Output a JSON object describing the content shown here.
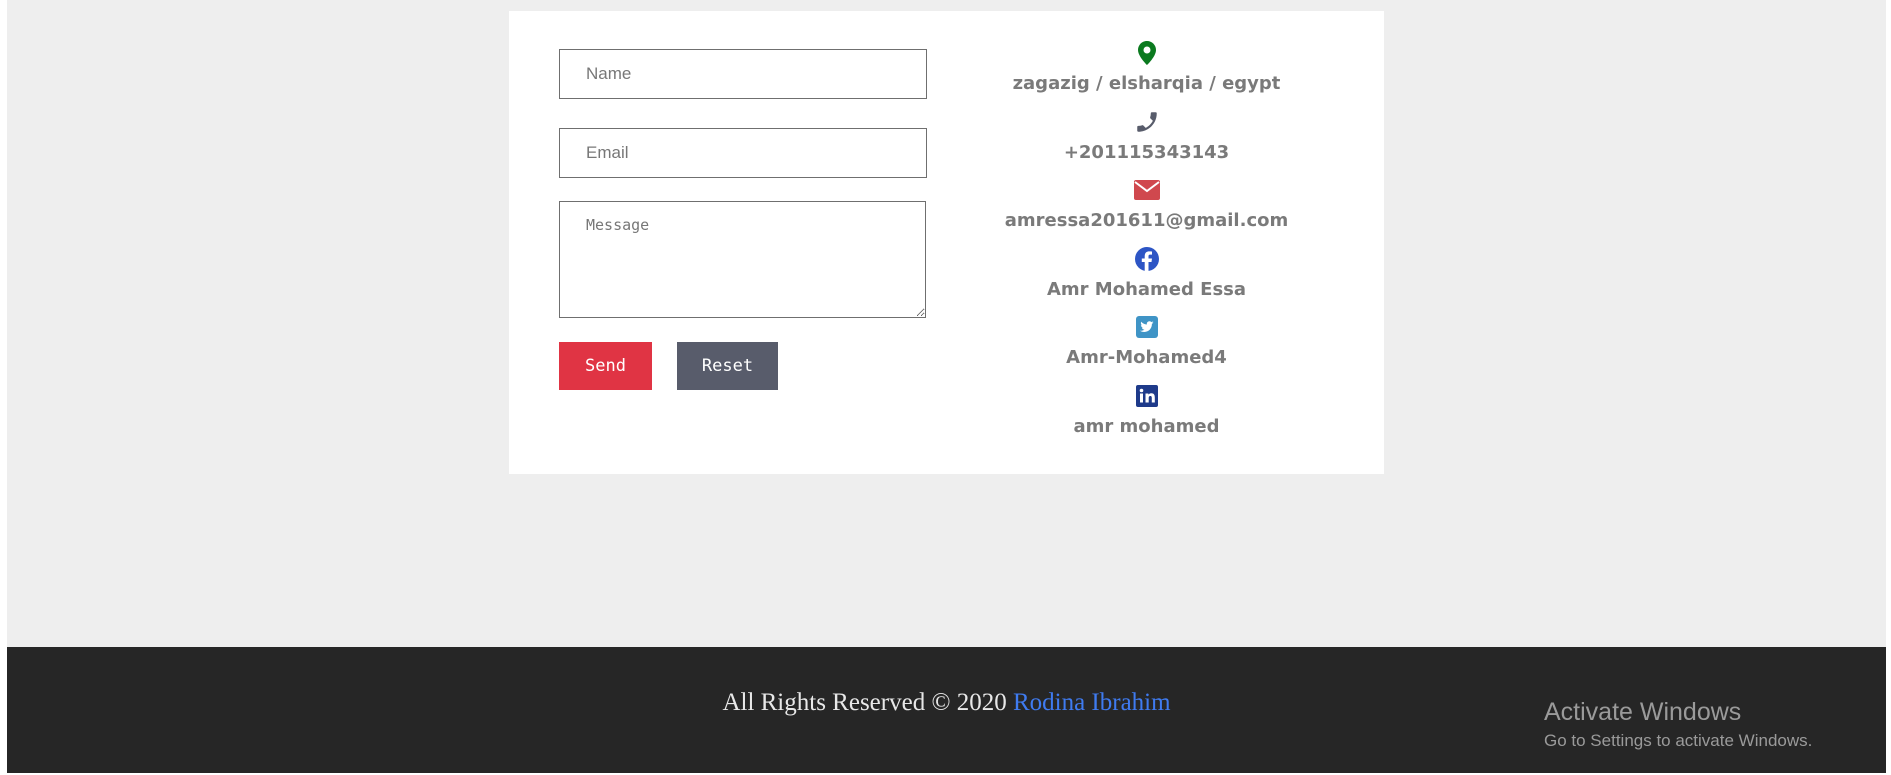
{
  "form": {
    "name_placeholder": "Name",
    "email_placeholder": "Email",
    "message_placeholder": "Message",
    "send_label": "Send",
    "reset_label": "Reset"
  },
  "contact": {
    "location": "zagazig / elsharqia / egypt",
    "phone": "+201115343143",
    "email": "amressa201611@gmail.com",
    "facebook": "Amr Mohamed Essa",
    "twitter": "Amr-Mohamed4",
    "linkedin": "amr mohamed"
  },
  "icons": {
    "location": "map-marker-icon",
    "phone": "phone-icon",
    "email": "envelope-icon",
    "facebook": "facebook-icon",
    "twitter": "twitter-icon",
    "linkedin": "linkedin-icon"
  },
  "colors": {
    "location_icon": "#0b7a1f",
    "phone_icon": "#585c6b",
    "email_icon": "#d0484e",
    "facebook_icon": "#2d55c5",
    "twitter_icon": "#3f94c6",
    "linkedin_icon": "#1e3a8a",
    "send_button": "#e03444",
    "reset_button": "#585c6b",
    "footer_bg": "#262626",
    "footer_link": "#3f7bf0"
  },
  "footer": {
    "text": "All Rights Reserved © 2020",
    "author": "Rodina Ibrahim"
  },
  "watermark": {
    "title": "Activate Windows",
    "subtitle": "Go to Settings to activate Windows."
  }
}
